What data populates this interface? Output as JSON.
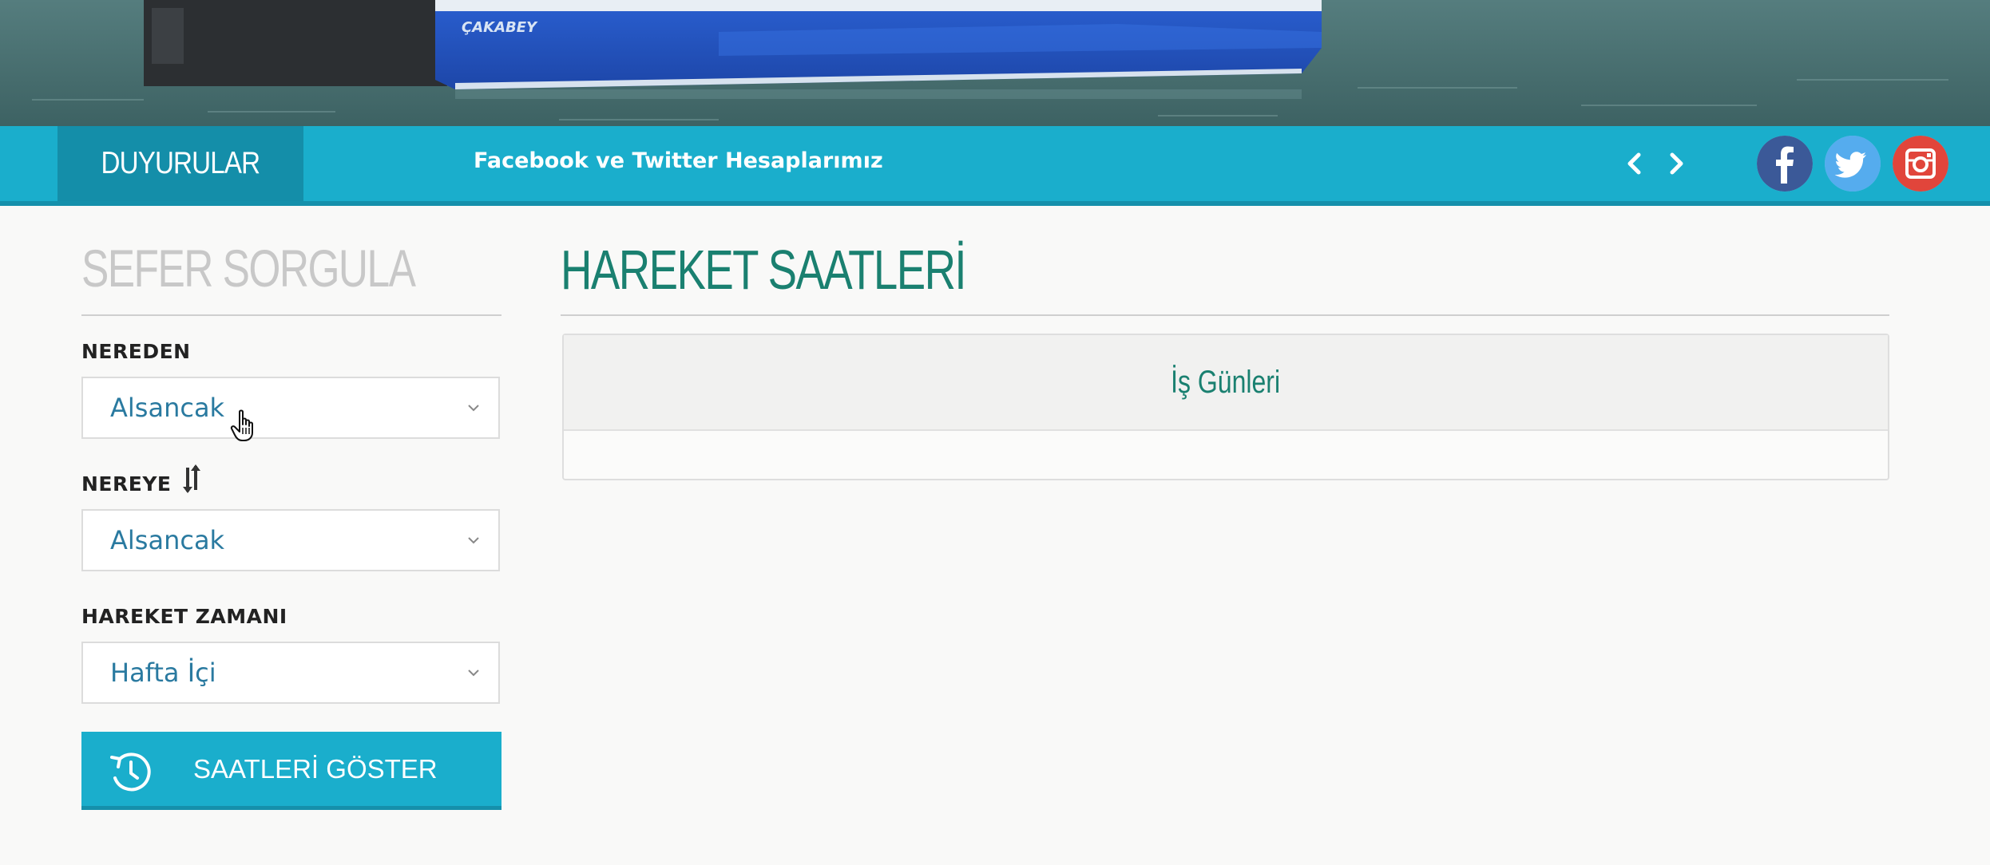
{
  "hero": {
    "ship_name": "ÇAKABEY"
  },
  "announcements": {
    "tab_label": "DUYURULAR",
    "current_text": "Facebook ve Twitter Hesaplarımız",
    "prev_icon": "chevron-left-icon",
    "next_icon": "chevron-right-icon"
  },
  "social": [
    {
      "name": "facebook",
      "icon": "facebook-icon",
      "color": "#3b5998"
    },
    {
      "name": "twitter",
      "icon": "twitter-icon",
      "color": "#55acee"
    },
    {
      "name": "instagram",
      "icon": "instagram-icon",
      "color": "#e1453b"
    }
  ],
  "search": {
    "title": "SEFER SORGULA",
    "from_label": "NEREDEN",
    "from_value": "Alsancak",
    "to_label": "NEREYE",
    "to_value": "Alsancak",
    "time_label": "HAREKET ZAMANI",
    "time_value": "Hafta İçi",
    "submit_label": "SAATLERİ GÖSTER"
  },
  "main": {
    "title": "HAREKET SAATLERİ",
    "panel_heading": "İş Günleri"
  },
  "colors": {
    "accent": "#1aaecc",
    "accent_dark": "#148ea9",
    "heading_green": "#1a8070",
    "select_text": "#2a7aa0"
  }
}
